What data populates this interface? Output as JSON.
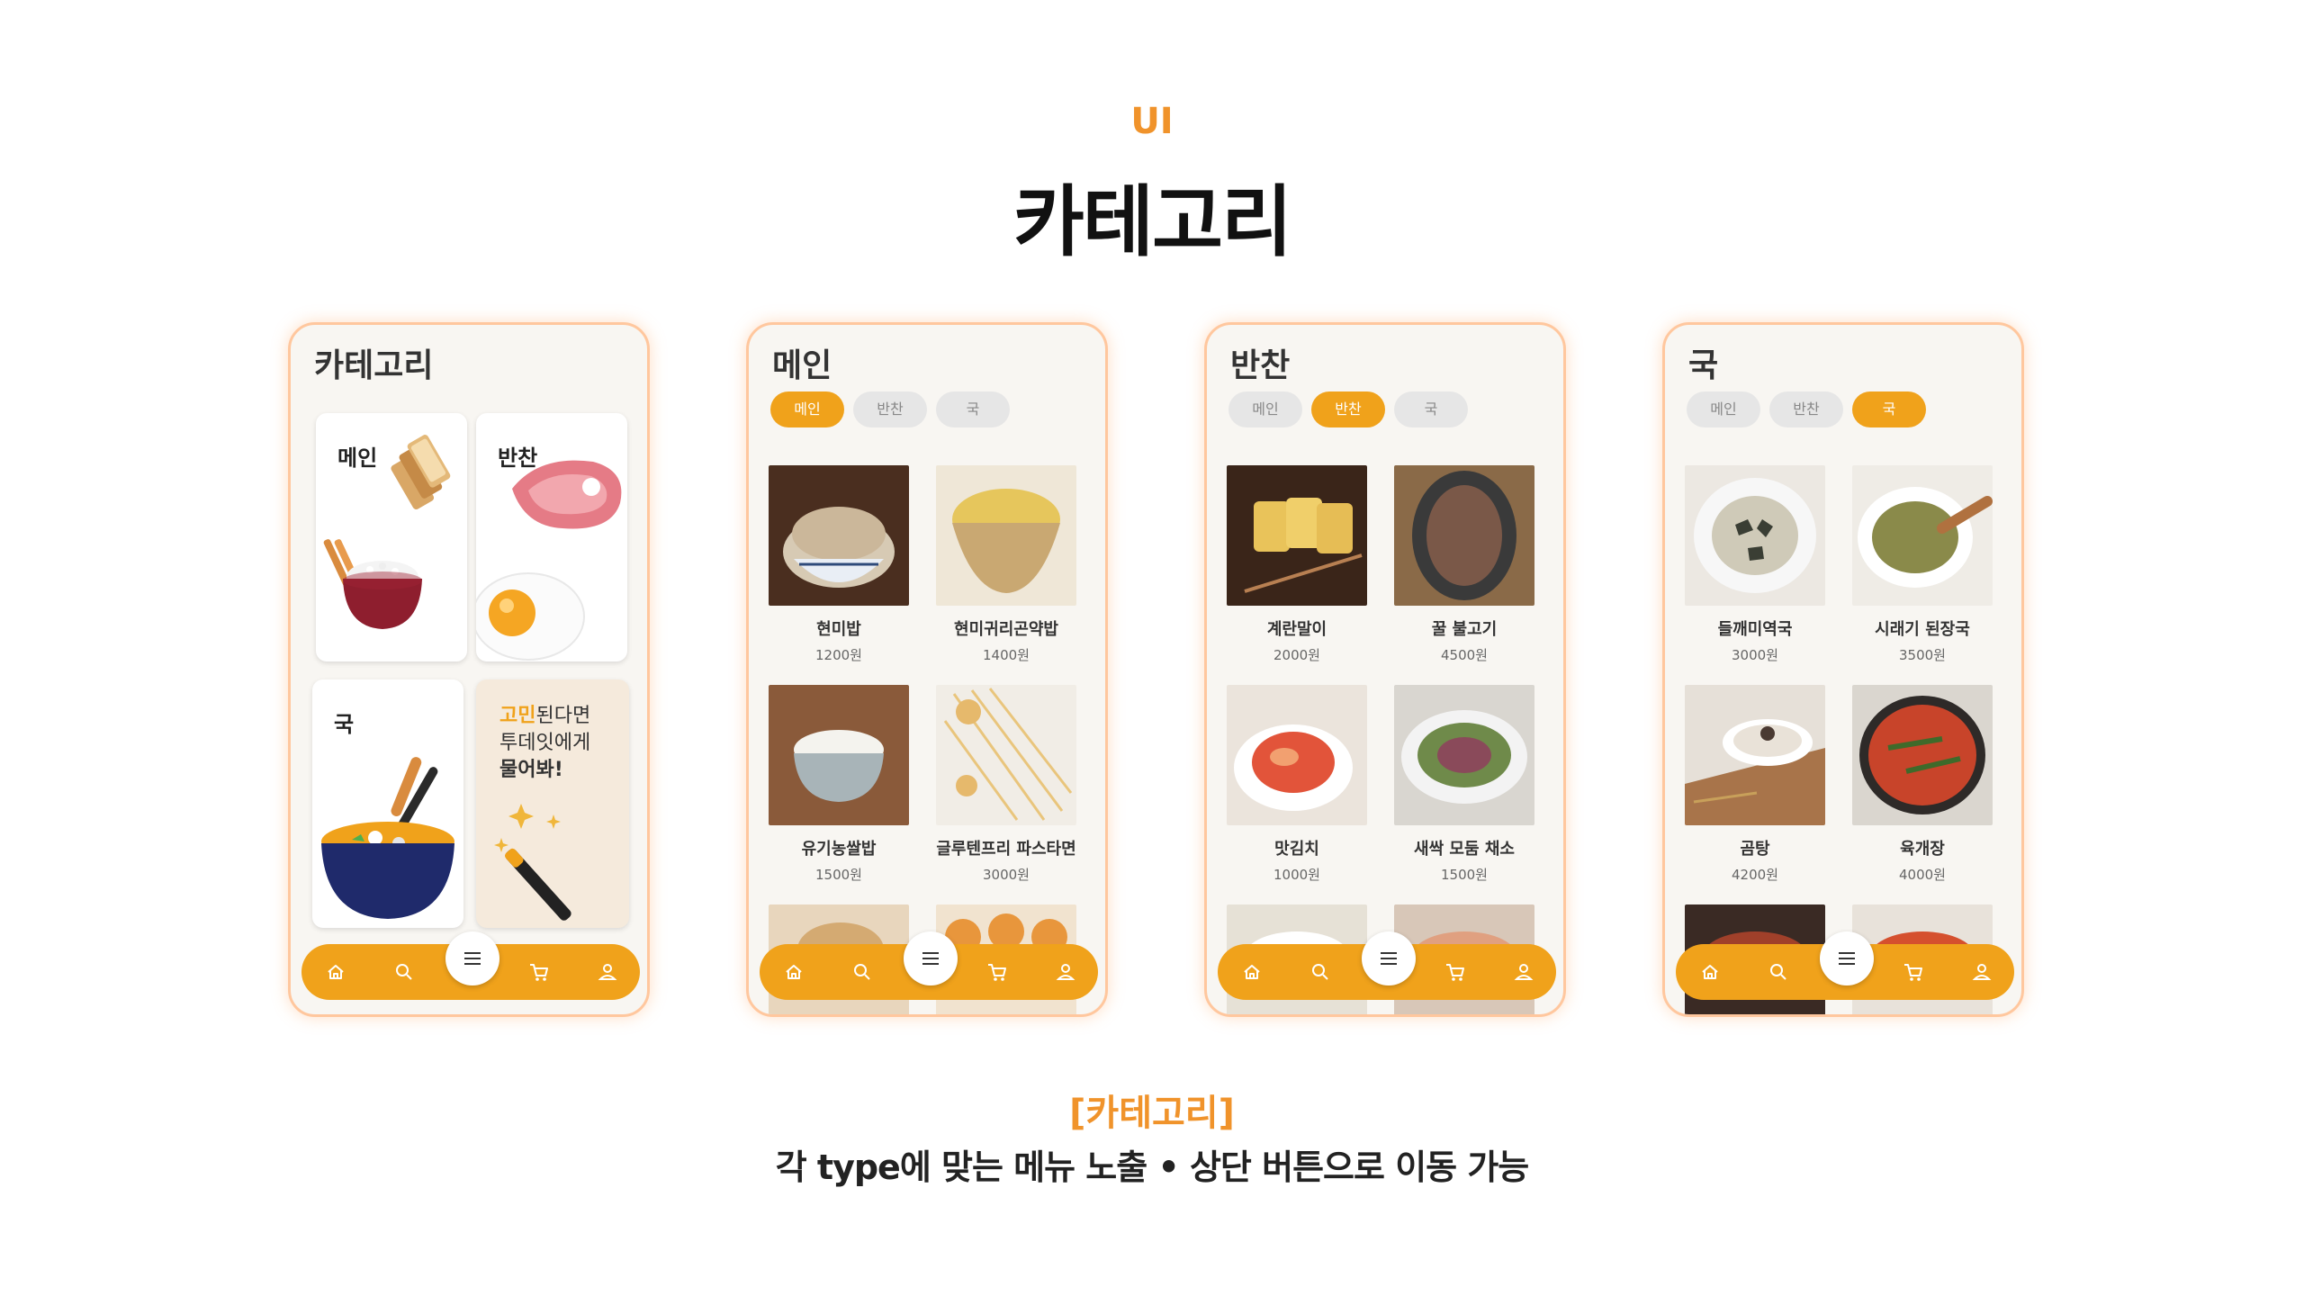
{
  "header": {
    "eyebrow": "UI",
    "title": "카테고리"
  },
  "caption": {
    "title": "[카테고리]",
    "text": "각 type에 맞는 메뉴 노출 • 상단 버튼으로 이동 가능"
  },
  "home_screen": {
    "title": "카테고리",
    "tiles": {
      "main": "메인",
      "side": "반찬",
      "soup": "국"
    },
    "ask": {
      "highlight": "고민",
      "line1_rest": "된다면",
      "line2": "투데잇에게",
      "line3": "물어봐!"
    }
  },
  "tabs": [
    "메인",
    "반찬",
    "국"
  ],
  "main_screen": {
    "title": "메인",
    "active_tab": "메인",
    "items": [
      {
        "name": "현미밥",
        "price": "1200원"
      },
      {
        "name": "현미귀리곤약밥",
        "price": "1400원"
      },
      {
        "name": "유기농쌀밥",
        "price": "1500원"
      },
      {
        "name": "글루텐프리 파스타면",
        "price": "3000원"
      }
    ]
  },
  "side_screen": {
    "title": "반찬",
    "active_tab": "반찬",
    "items": [
      {
        "name": "계란말이",
        "price": "2000원"
      },
      {
        "name": "꿀 불고기",
        "price": "4500원"
      },
      {
        "name": "맛김치",
        "price": "1000원"
      },
      {
        "name": "새싹 모둠 채소",
        "price": "1500원"
      }
    ]
  },
  "soup_screen": {
    "title": "국",
    "active_tab": "국",
    "items": [
      {
        "name": "들깨미역국",
        "price": "3000원"
      },
      {
        "name": "시래기 된장국",
        "price": "3500원"
      },
      {
        "name": "곰탕",
        "price": "4200원"
      },
      {
        "name": "육개장",
        "price": "4000원"
      }
    ]
  },
  "nav_icons": [
    "home-icon",
    "search-icon",
    "menu-icon",
    "cart-icon",
    "user-icon"
  ],
  "colors": {
    "accent": "#f0a21b",
    "eyebrow": "#f0932b",
    "phone_border": "#ffc79e"
  }
}
